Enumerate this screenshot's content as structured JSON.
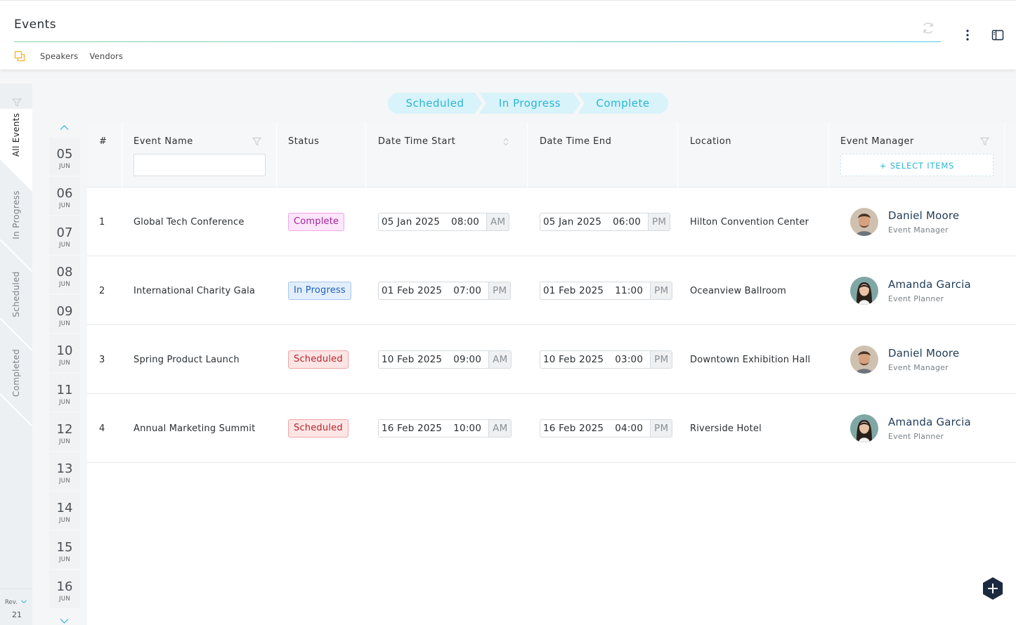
{
  "header": {
    "title": "Events",
    "subnav": [
      "Speakers",
      "Vendors"
    ]
  },
  "sidebar": {
    "tabs": [
      {
        "label": "All Events",
        "active": true
      },
      {
        "label": "In Progress",
        "active": false
      },
      {
        "label": "Scheduled",
        "active": false
      },
      {
        "label": "Completed",
        "active": false
      }
    ],
    "rev_label": "Rev.",
    "rev_number": "21"
  },
  "dates": [
    {
      "day": "05",
      "month": "JUN"
    },
    {
      "day": "06",
      "month": "JUN"
    },
    {
      "day": "07",
      "month": "JUN"
    },
    {
      "day": "08",
      "month": "JUN"
    },
    {
      "day": "09",
      "month": "JUN"
    },
    {
      "day": "10",
      "month": "JUN"
    },
    {
      "day": "11",
      "month": "JUN"
    },
    {
      "day": "12",
      "month": "JUN"
    },
    {
      "day": "13",
      "month": "JUN"
    },
    {
      "day": "14",
      "month": "JUN"
    },
    {
      "day": "15",
      "month": "JUN"
    },
    {
      "day": "16",
      "month": "JUN"
    }
  ],
  "steps": [
    "Scheduled",
    "In Progress",
    "Complete"
  ],
  "table": {
    "columns": {
      "index": "#",
      "name": "Event Name",
      "status": "Status",
      "start": "Date Time Start",
      "end": "Date Time End",
      "location": "Location",
      "manager": "Event Manager"
    },
    "name_filter_value": "",
    "select_items_label": "+ SELECT ITEMS",
    "rows": [
      {
        "index": "1",
        "name": "Global Tech Conference",
        "status": "Complete",
        "status_type": "complete",
        "start_date": "05 Jan 2025",
        "start_time": "08:00",
        "start_ampm": "AM",
        "end_date": "05 Jan 2025",
        "end_time": "06:00",
        "end_ampm": "PM",
        "location": "Hilton Convention Center",
        "manager": "Daniel Moore",
        "manager_role": "Event Manager",
        "avatar": "male"
      },
      {
        "index": "2",
        "name": "International Charity Gala",
        "status": "In Progress",
        "status_type": "progress",
        "start_date": "01 Feb 2025",
        "start_time": "07:00",
        "start_ampm": "PM",
        "end_date": "01 Feb 2025",
        "end_time": "11:00",
        "end_ampm": "PM",
        "location": "Oceanview Ballroom",
        "manager": "Amanda Garcia",
        "manager_role": "Event Planner",
        "avatar": "female"
      },
      {
        "index": "3",
        "name": "Spring Product Launch",
        "status": "Scheduled",
        "status_type": "scheduled",
        "start_date": "10 Feb 2025",
        "start_time": "09:00",
        "start_ampm": "AM",
        "end_date": "10 Feb 2025",
        "end_time": "03:00",
        "end_ampm": "PM",
        "location": "Downtown Exhibition Hall",
        "manager": "Daniel Moore",
        "manager_role": "Event Manager",
        "avatar": "male"
      },
      {
        "index": "4",
        "name": "Annual Marketing Summit",
        "status": "Scheduled",
        "status_type": "scheduled",
        "start_date": "16 Feb 2025",
        "start_time": "10:00",
        "start_ampm": "AM",
        "end_date": "16 Feb 2025",
        "end_time": "04:00",
        "end_ampm": "PM",
        "location": "Riverside Hotel",
        "manager": "Amanda Garcia",
        "manager_role": "Event Planner",
        "avatar": "female"
      }
    ]
  },
  "colors": {
    "accent": "#2ab5d6",
    "step_bg": "#d8f3f9",
    "fab": "#1b2a3f"
  }
}
